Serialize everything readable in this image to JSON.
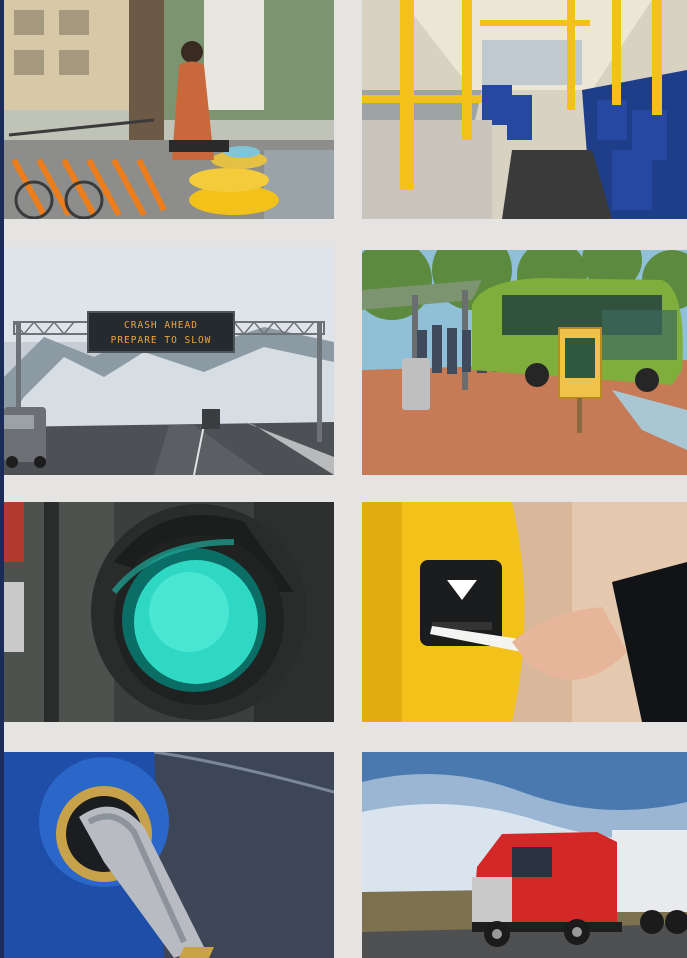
{
  "photos": [
    {
      "subject": "bike-share"
    },
    {
      "subject": "bus-interior"
    },
    {
      "subject": "highway-sign",
      "sign_line1": "CRASH AHEAD",
      "sign_line2": "PREPARE TO SLOW"
    },
    {
      "subject": "bus-stop"
    },
    {
      "subject": "traffic-light"
    },
    {
      "subject": "fare-card-reader"
    },
    {
      "subject": "ev-charger"
    },
    {
      "subject": "semi-truck"
    }
  ],
  "colors": {
    "frame": "#1c2c5a",
    "background": "#e6e4e3",
    "accent_yellow": "#f2c21b",
    "accent_orange": "#ec7d1a",
    "signal_green": "#2fd8c2"
  }
}
